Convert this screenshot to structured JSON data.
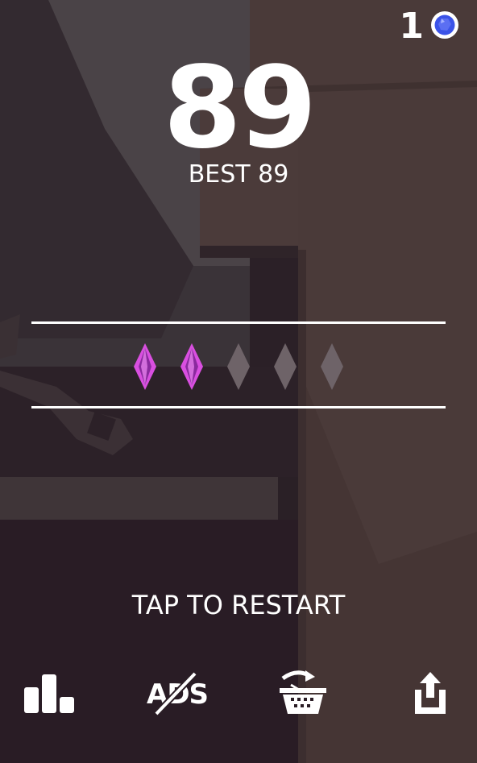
{
  "hud": {
    "gem_count": "1",
    "gem_icon": "blue-gem-icon"
  },
  "score": {
    "value": "89",
    "best_label": "BEST 89"
  },
  "crystals": {
    "collected": 2,
    "total": 5,
    "collected_color": "#d94fe0",
    "empty_color": "#6e6368"
  },
  "restart_text": "TAP TO RESTART",
  "toolbar": {
    "leaderboard_icon": "leaderboard-icon",
    "no_ads_label": "ADS",
    "shop_icon": "shop-basket-icon",
    "share_icon": "share-icon"
  },
  "colors": {
    "text": "#ffffff",
    "gem_blue": "#3b53e8",
    "crystal_pink": "#d94fe0"
  }
}
